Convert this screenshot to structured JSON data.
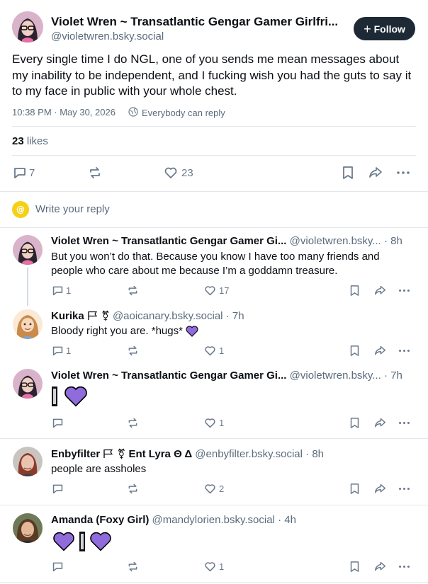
{
  "main_post": {
    "display_name": "Violet Wren ~ Transatlantic Gengar Gamer Girlfri...",
    "handle": "@violetwren.bsky.social",
    "follow_label": "Follow",
    "text": "Every single time I do NGL, one of you sends me mean messages about my inability to be independent, and I fucking wish you had the guts to say it to my face in public with your whole chest.",
    "timestamp": "10:38 PM · May 30, 2026",
    "reply_setting": "Everybody can reply",
    "likes_count": "23",
    "likes_label": "likes",
    "reply_count": "7",
    "like_count": "23"
  },
  "composer": {
    "placeholder": "Write your reply"
  },
  "replies": [
    {
      "display_name": "Violet Wren ~ Transatlantic Gengar Gamer Gi...",
      "handle": "@violetwren.bsky...",
      "time": "· 8h",
      "text": "But you won’t do that. Because you know I have too many friends and people who care about me because I’m a goddamn treasure.",
      "reply_count": "1",
      "like_count": "17"
    },
    {
      "display_name": "Kurika",
      "handle": "@aoicanary.bsky.social",
      "time": "· 7h",
      "text": "Bloody right you are. *hugs*",
      "reply_count": "1",
      "like_count": "1"
    },
    {
      "display_name": "Violet Wren ~ Transatlantic Gengar Gamer Gi...",
      "handle": "@violetwren.bsky...",
      "time": "· 7h",
      "text": "",
      "reply_count": "",
      "like_count": "1"
    },
    {
      "display_name": "Enbyfilter",
      "name_suffix": "Ent Lyra Θ Δ",
      "handle": "@enbyfilter.bsky.social",
      "time": "· 8h",
      "text": "people are assholes",
      "reply_count": "",
      "like_count": "2"
    },
    {
      "display_name": "Amanda (Foxy Girl)",
      "handle": "@mandylorien.bsky.social",
      "time": "· 4h",
      "text": "",
      "reply_count": "",
      "like_count": "1"
    }
  ],
  "colors": {
    "accent": "#1083fe",
    "follow_bg": "#1e2936",
    "heart_purple": "#8f6bdc",
    "muted_text": "#5b6b7c",
    "composer_avatar": "#f5d018"
  },
  "icons": [
    "reply-icon",
    "repost-icon",
    "like-icon",
    "bookmark-icon",
    "share-icon",
    "more-icon",
    "globe-icon",
    "plus-icon"
  ]
}
